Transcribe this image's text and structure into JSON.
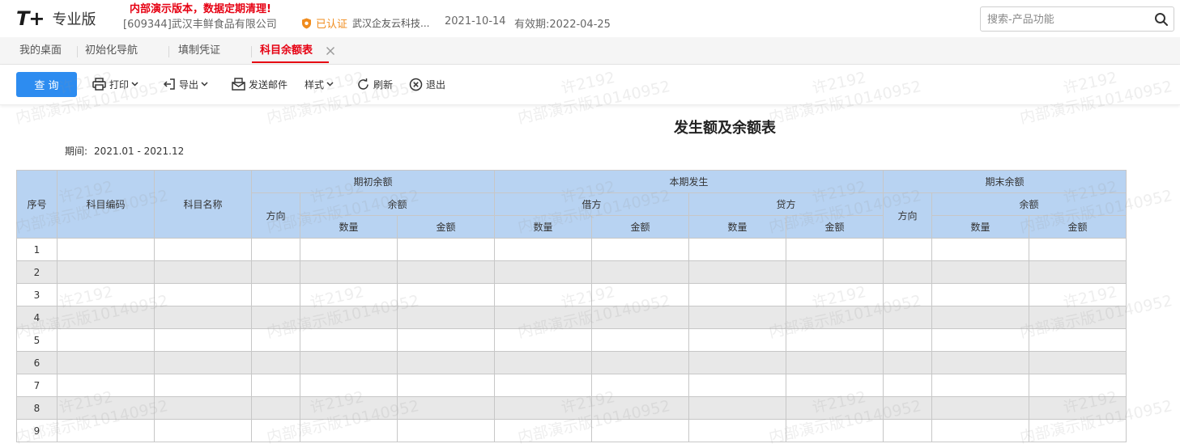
{
  "header": {
    "logo_mark": "T+",
    "edition": "专业版",
    "demo_warning": "内部演示版本，数据定期清理!",
    "company": "[609344]武汉丰鲜食品有限公司",
    "certified_label": "已认证",
    "certified_org": "武汉企友云科技...",
    "date": "2021-10-14",
    "valid_until": "有效期:2022-04-25",
    "search_placeholder": "搜索-产品功能"
  },
  "tabs": [
    {
      "label": "我的桌面",
      "active": false
    },
    {
      "label": "初始化导航",
      "active": false
    },
    {
      "label": "填制凭证",
      "active": false
    },
    {
      "label": "科目余额表",
      "active": true
    }
  ],
  "toolbar": {
    "query_label": "查 询",
    "print_label": "打印",
    "export_label": "导出",
    "email_label": "发送邮件",
    "style_label": "样式",
    "refresh_label": "刷新",
    "exit_label": "退出"
  },
  "report": {
    "title": "发生额及余额表",
    "period_label": "期间:",
    "period_value": "2021.01 - 2021.12"
  },
  "table": {
    "headers": {
      "seq": "序号",
      "code": "科目编码",
      "name": "科目名称",
      "opening": "期初余额",
      "current": "本期发生",
      "closing": "期末余额",
      "direction": "方向",
      "balance": "余额",
      "debit": "借方",
      "credit": "贷方",
      "qty": "数量",
      "amount": "金额"
    },
    "rows": [
      "1",
      "2",
      "3",
      "4",
      "5",
      "6",
      "7",
      "8",
      "9"
    ]
  },
  "watermark": {
    "name": "许2192",
    "edition": "内部演示版10140952"
  },
  "colors": {
    "brand_red": "#e60012",
    "primary_blue": "#2d8cf0",
    "header_blue": "#b8d3f2",
    "certified_orange": "#f08c1e"
  }
}
